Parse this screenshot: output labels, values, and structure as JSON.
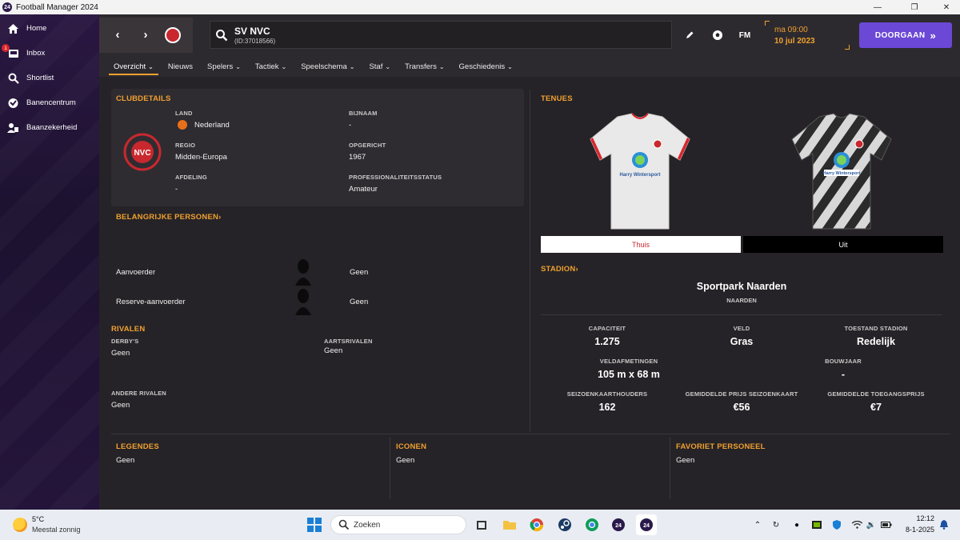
{
  "window": {
    "title": "Football Manager 2024",
    "app_icon_text": "24"
  },
  "sidebar": {
    "items": [
      {
        "label": "Home",
        "icon": "home-icon"
      },
      {
        "label": "Inbox",
        "icon": "inbox-icon",
        "badge": "1"
      },
      {
        "label": "Shortlist",
        "icon": "search-icon"
      },
      {
        "label": "Banencentrum",
        "icon": "job-centre-icon"
      },
      {
        "label": "Baanzekerheid",
        "icon": "job-security-icon"
      }
    ]
  },
  "header": {
    "club_name": "SV NVC",
    "club_id": "(ID:37018566)",
    "fm_label": "FM",
    "time": "ma 09:00",
    "date": "10 jul 2023",
    "continue_label": "DOORGAAN"
  },
  "tabs": [
    {
      "label": "Overzicht",
      "dropdown": true,
      "active": true
    },
    {
      "label": "Nieuws",
      "dropdown": false
    },
    {
      "label": "Spelers",
      "dropdown": true
    },
    {
      "label": "Tactiek",
      "dropdown": true
    },
    {
      "label": "Speelschema",
      "dropdown": true
    },
    {
      "label": "Staf",
      "dropdown": true
    },
    {
      "label": "Transfers",
      "dropdown": true
    },
    {
      "label": "Geschiedenis",
      "dropdown": true
    }
  ],
  "clubdetails": {
    "title": "CLUBDETAILS",
    "land_label": "LAND",
    "land_value": "Nederland",
    "bijnaam_label": "BIJNAAM",
    "bijnaam_value": "-",
    "regio_label": "REGIO",
    "regio_value": "Midden-Europa",
    "opgericht_label": "OPGERICHT",
    "opgericht_value": "1967",
    "afdeling_label": "AFDELING",
    "afdeling_value": "-",
    "status_label": "PROFESSIONALITEITSSTATUS",
    "status_value": "Amateur"
  },
  "key_people": {
    "title": "BELANGRIJKE PERSONEN",
    "rows": [
      {
        "role": "Aanvoerder",
        "name": "Geen"
      },
      {
        "role": "Reserve-aanvoerder",
        "name": "Geen"
      }
    ]
  },
  "rivals": {
    "title": "RIVALEN",
    "derbys_label": "DERBY'S",
    "derbys_value": "Geen",
    "arch_label": "AARTSRIVALEN",
    "arch_value": "Geen",
    "other_label": "ANDERE RIVALEN",
    "other_value": "Geen"
  },
  "kits": {
    "title": "TENUES",
    "home_label": "Thuis",
    "away_label": "Uit",
    "sponsor": "Harry Wintersport",
    "colors": {
      "home_shirt": "#e9e9e9",
      "home_trim": "#d9262d",
      "away_shirt": "#2b2b2b"
    }
  },
  "stadium": {
    "title": "STADION",
    "name": "Sportpark Naarden",
    "city": "NAARDEN",
    "stats": [
      {
        "label": "CAPACITEIT",
        "value": "1.275"
      },
      {
        "label": "VELD",
        "value": "Gras"
      },
      {
        "label": "TOESTAND STADION",
        "value": "Redelijk"
      },
      {
        "label": "VELDAFMETINGEN",
        "value": "105 m x 68 m"
      },
      {
        "label": "BOUWJAAR",
        "value": "-"
      },
      {
        "label": "SEIZOENKAARTHOUDERS",
        "value": "162"
      },
      {
        "label": "GEMIDDELDE PRIJS SEIZOENKAART",
        "value": "€56"
      },
      {
        "label": "GEMIDDELDE TOEGANGSPRIJS",
        "value": "€7"
      }
    ]
  },
  "bottom": {
    "legends_title": "LEGENDES",
    "legends_value": "Geen",
    "icons_title": "ICONEN",
    "icons_value": "Geen",
    "fav_title": "FAVORIET PERSONEEL",
    "fav_value": "Geen"
  },
  "taskbar": {
    "temperature": "5°C",
    "weather": "Meestal zonnig",
    "search_placeholder": "Zoeken",
    "time": "12:12",
    "date": "8-1-2025"
  },
  "theme": {
    "accent": "#f0a030",
    "primary_button": "#6b48d6",
    "club_red": "#c8282e"
  }
}
